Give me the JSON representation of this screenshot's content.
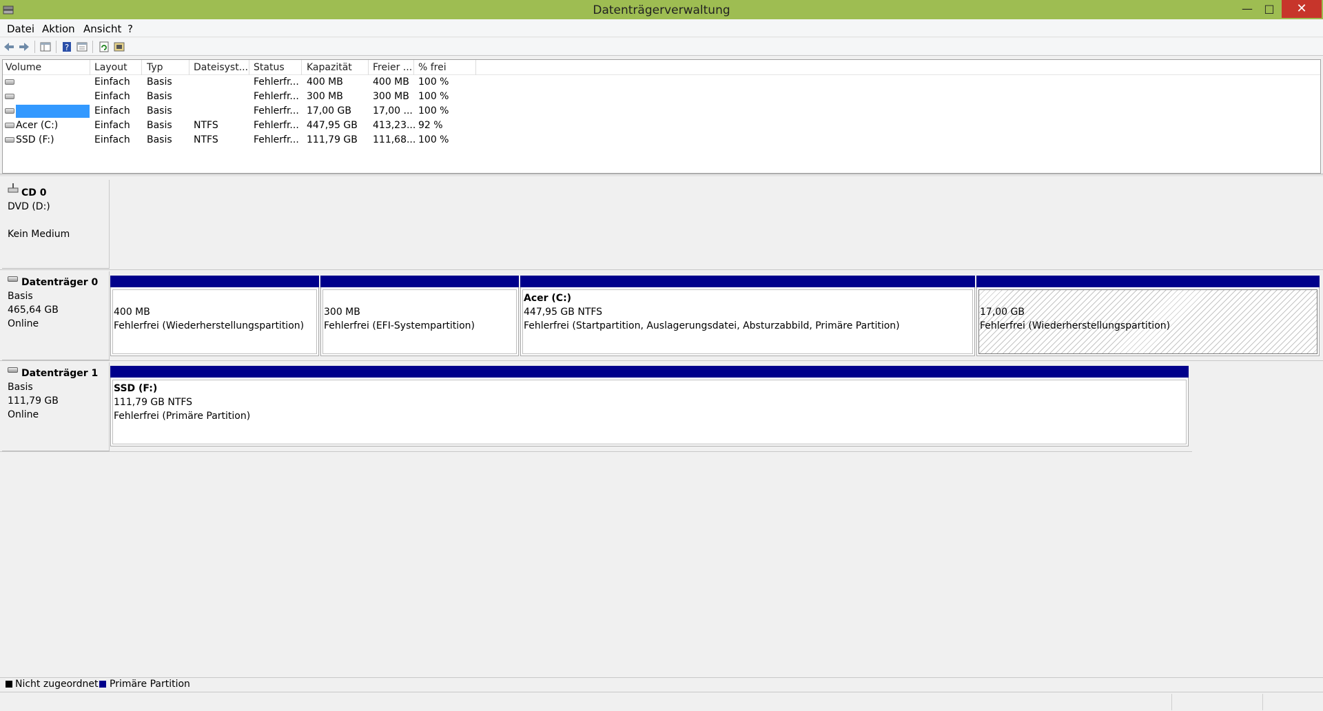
{
  "window": {
    "title": "Datenträgerverwaltung",
    "controls": {
      "minimize": "—",
      "maximize": "□",
      "close": "✕"
    }
  },
  "menu": [
    "Datei",
    "Aktion",
    "Ansicht",
    "?"
  ],
  "toolbar": {
    "icons": [
      "back-arrow-icon",
      "forward-arrow-icon",
      "console-tree-icon",
      "help-icon",
      "properties-icon",
      "refresh-icon",
      "rescan-disks-icon"
    ]
  },
  "volume_list": {
    "columns": [
      "Volume",
      "Layout",
      "Typ",
      "Dateisyst...",
      "Status",
      "Kapazität",
      "Freier ...",
      "% frei"
    ],
    "rows": [
      {
        "volume": "",
        "layout": "Einfach",
        "typ": "Basis",
        "fs": "",
        "status": "Fehlerfr...",
        "capacity": "400 MB",
        "free": "400 MB",
        "pct": "100 %"
      },
      {
        "volume": "",
        "layout": "Einfach",
        "typ": "Basis",
        "fs": "",
        "status": "Fehlerfr...",
        "capacity": "300 MB",
        "free": "300 MB",
        "pct": "100 %"
      },
      {
        "volume": "",
        "layout": "Einfach",
        "typ": "Basis",
        "fs": "",
        "status": "Fehlerfr...",
        "capacity": "17,00 GB",
        "free": "17,00 ...",
        "pct": "100 %"
      },
      {
        "volume": "Acer (C:)",
        "layout": "Einfach",
        "typ": "Basis",
        "fs": "NTFS",
        "status": "Fehlerfr...",
        "capacity": "447,95 GB",
        "free": "413,23...",
        "pct": "92 %"
      },
      {
        "volume": "SSD (F:)",
        "layout": "Einfach",
        "typ": "Basis",
        "fs": "NTFS",
        "status": "Fehlerfr...",
        "capacity": "111,79 GB",
        "free": "111,68...",
        "pct": "100 %"
      }
    ]
  },
  "disks": {
    "cd0": {
      "name": "CD 0",
      "drive": "DVD (D:)",
      "media": "Kein Medium"
    },
    "disk0": {
      "name": "Datenträger 0",
      "type": "Basis",
      "size": "465,64 GB",
      "state": "Online",
      "partitions": [
        {
          "title": "",
          "line1": "400 MB",
          "line2": "Fehlerfrei (Wiederherstellungspartition)"
        },
        {
          "title": "",
          "line1": "300 MB",
          "line2": "Fehlerfrei (EFI-Systempartition)"
        },
        {
          "title": "Acer  (C:)",
          "line1": "447,95 GB NTFS",
          "line2": "Fehlerfrei (Startpartition, Auslagerungsdatei, Absturzabbild, Primäre Partition)"
        },
        {
          "title": "",
          "line1": "17,00 GB",
          "line2": "Fehlerfrei (Wiederherstellungspartition)"
        }
      ]
    },
    "disk1": {
      "name": "Datenträger 1",
      "type": "Basis",
      "size": "111,79 GB",
      "state": "Online",
      "partitions": [
        {
          "title": "SSD  (F:)",
          "line1": "111,79 GB NTFS",
          "line2": "Fehlerfrei (Primäre Partition)"
        }
      ]
    }
  },
  "legend": [
    {
      "label": "Nicht zugeordnet",
      "color": "#000000"
    },
    {
      "label": "Primäre Partition",
      "color": "#00008b"
    }
  ],
  "colors": {
    "titlebar": "#9ebd52",
    "primary_partition": "#00008b",
    "selection": "#3399ff",
    "close_button": "#c7352b"
  }
}
